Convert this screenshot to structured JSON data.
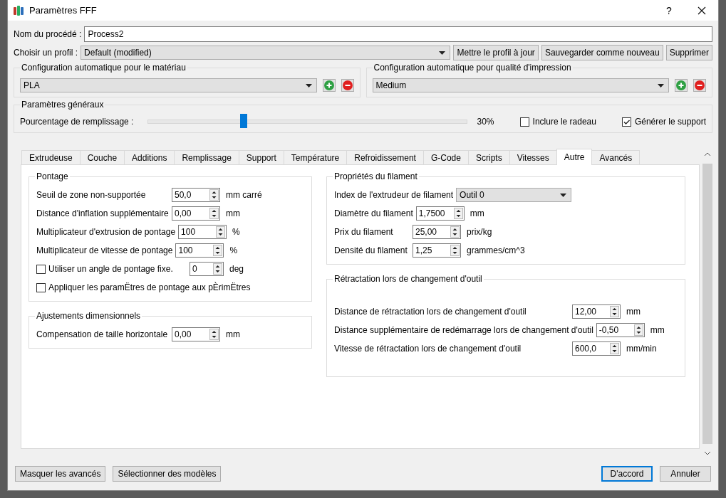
{
  "window": {
    "title": "Paramètres FFF",
    "help": "?"
  },
  "process": {
    "label": "Nom du procédé :",
    "value": "Process2"
  },
  "profile": {
    "label": "Choisir un profil :",
    "value": "Default (modified)",
    "buttons": [
      "Mettre le profil à jour",
      "Sauvegarder comme nouveau",
      "Supprimer"
    ]
  },
  "auto_groups": [
    {
      "title": "Configuration automatique pour le matériau",
      "value": "PLA"
    },
    {
      "title": "Configuration automatique pour qualité d'impression",
      "value": "Medium"
    }
  ],
  "general": {
    "title": "Paramètres généraux",
    "infill_label": "Pourcentage de remplissage :",
    "level": 0.3,
    "reading": "30%",
    "checkboxes": [
      {
        "label": "Inclure le radeau",
        "checked": false
      },
      {
        "label": "Générer le support",
        "checked": true
      }
    ]
  },
  "tabs": [
    {
      "label": "Extrudeuse",
      "selected": false
    },
    {
      "label": "Couche",
      "selected": false
    },
    {
      "label": "Additions",
      "selected": false
    },
    {
      "label": "Remplissage",
      "selected": false
    },
    {
      "label": "Support",
      "selected": false
    },
    {
      "label": "Température",
      "selected": false
    },
    {
      "label": "Refroidissement",
      "selected": false
    },
    {
      "label": "G-Code",
      "selected": false
    },
    {
      "label": "Scripts",
      "selected": false
    },
    {
      "label": "Vitesses",
      "selected": false
    },
    {
      "label": "Autre",
      "selected": true
    },
    {
      "label": "Avancés",
      "selected": false
    }
  ],
  "columns": [
    [
      {
        "title": "Pontage",
        "rows": [
          {
            "kind": "spin",
            "label": "Seuil de zone non-supportée",
            "value": "50,0",
            "unit": "mm carré"
          },
          {
            "kind": "spin",
            "label": "Distance d'inflation supplémentaire",
            "value": "0,00",
            "unit": "mm"
          },
          {
            "kind": "spin",
            "label": "Multiplicateur d'extrusion de pontage",
            "value": "100",
            "unit": "%"
          },
          {
            "kind": "spin",
            "label": "Multiplicateur de vitesse de pontage",
            "value": "100",
            "unit": "%"
          },
          {
            "kind": "check_spin",
            "label": "Utiliser un angle de pontage fixe.",
            "checked": false,
            "value": "0",
            "unit": "deg"
          },
          {
            "kind": "check",
            "label": "Appliquer les paramËtres de pontage aux pÈrimËtres",
            "checked": false
          }
        ]
      },
      {
        "title": "Ajustements dimensionnels",
        "rows": [
          {
            "kind": "spin",
            "label": "Compensation de taille horizontale",
            "value": "0,00",
            "unit": "mm"
          }
        ]
      }
    ],
    [
      {
        "title": "Propriétés du filament",
        "rows": [
          {
            "kind": "combo",
            "label": "Index de l'extrudeur de filament",
            "value": "Outil 0"
          },
          {
            "kind": "spin",
            "label": "Diamètre du filament",
            "value": "1,7500",
            "unit": "mm"
          },
          {
            "kind": "spin",
            "label": "Prix du filament",
            "value": "25,00",
            "unit": "prix/kg"
          },
          {
            "kind": "spin",
            "label": "Densité du filament",
            "value": "1,25",
            "unit": "grammes/cm^3"
          }
        ]
      },
      {
        "title": "Rétractation lors de changement d'outil",
        "rows": [
          {
            "kind": "spin",
            "label": "Distance de rétractation lors de changement d'outil",
            "value": "12,00",
            "unit": "mm"
          },
          {
            "kind": "spin",
            "label": "Distance supplémentaire de redémarrage lors de changement d'outil",
            "value": "-0,50",
            "unit": "mm"
          },
          {
            "kind": "spin",
            "label": "Vitesse de rétractation lors de changement d'outil",
            "value": "600,0",
            "unit": "mm/min"
          }
        ]
      }
    ]
  ],
  "footer": {
    "left": [
      {
        "label": "Masquer les avancés",
        "default": false
      },
      {
        "label": "Sélectionner des modèles",
        "default": false
      }
    ],
    "right": [
      {
        "label": "D'accord",
        "default": true
      },
      {
        "label": "Annuler",
        "default": false
      }
    ]
  }
}
